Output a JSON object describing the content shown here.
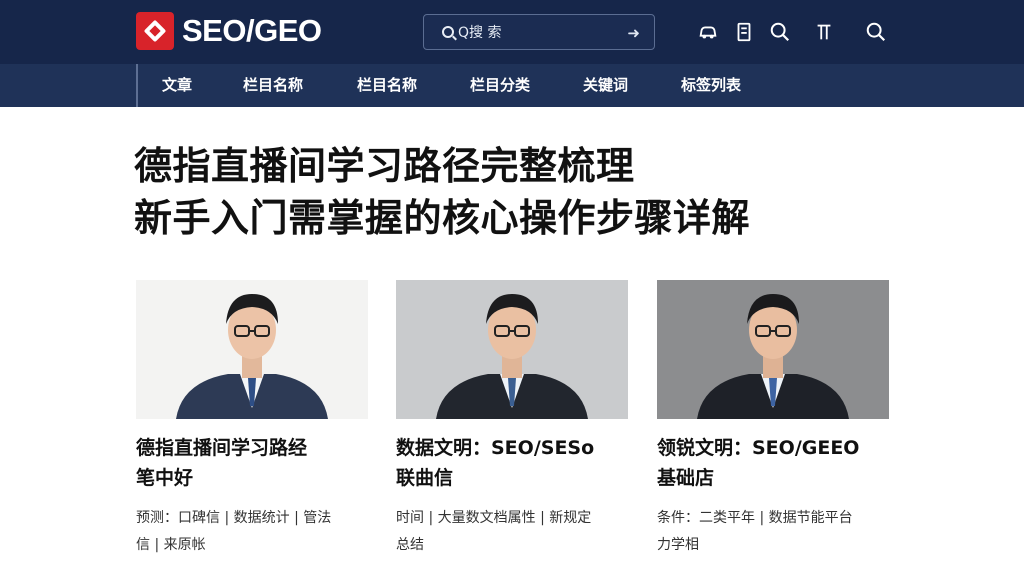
{
  "header": {
    "logo_text": "SEO/GEO",
    "search_placeholder": "Q搜 索",
    "icons": [
      "car-icon",
      "document-icon",
      "search-icon",
      "bookmark-icon",
      "search-icon"
    ]
  },
  "nav": {
    "items": [
      "文章",
      "栏目名称",
      "栏目名称",
      "栏目分类",
      "关键词",
      "标签列表"
    ]
  },
  "article": {
    "headline_line1": "德指直播间学习路径完整梳理",
    "headline_line2": "新手入门需掌握的核心操作步骤详解"
  },
  "cards": [
    {
      "title_line1": "德指直播间学习路经",
      "title_line2": "笔中好",
      "meta_line1": "预测：口碑信 | 数据统计 | 管法",
      "meta_line2": "信 | 来原帐"
    },
    {
      "title_line1": "数据文明：SEO/SESo",
      "title_line2": "联曲信",
      "meta_line1": "时间 | 大量数文档属性 | 新规定",
      "meta_line2": "总结"
    },
    {
      "title_line1": "领锐文明：SEO/GEEO",
      "title_line2": "基础店",
      "meta_line1": "条件：二类平年 | 数据节能平台",
      "meta_line2": "力学相"
    }
  ],
  "colors": {
    "header_bg": "#16264a",
    "nav_bg": "#1f3258",
    "logo_red": "#d8232a",
    "text_dark": "#111111"
  }
}
